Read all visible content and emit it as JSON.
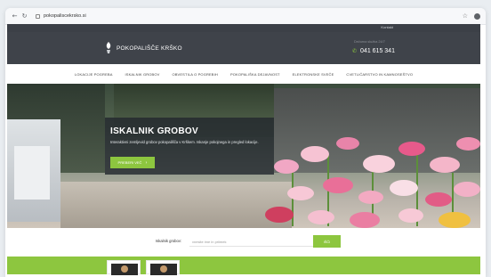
{
  "browser": {
    "url": "pokopaliscekrsko.si",
    "back_icon": "back-arrow-icon",
    "reload_icon": "reload-icon"
  },
  "site": {
    "kontakt": "Kontakt",
    "logo_text": "POKOPALIŠČE KRŠKO",
    "phone_label": "Dežurna služba 24/7",
    "phone": "041 615 341"
  },
  "nav": {
    "items": [
      "LOKACIJE POGREBA",
      "ISKALNIK GROBOV",
      "OBVESTILA O POGREBIH",
      "POKOPALIŠKA DEJAVNOST",
      "ELEKTRONSKE SVEČE",
      "CVETLIČARSTVO IN KAMNOSEŠTVO"
    ]
  },
  "hero": {
    "title": "ISKALNIK GROBOV",
    "description": "Interaktivni zemljevid grobov pokopališča v Krškem. Iskanje pokojnega in pregled lokacije.",
    "button_label": "PREBERI VEČ"
  },
  "search": {
    "label": "Iskalnik grobov:",
    "placeholder": "vnesite ime in priimek",
    "button_label": "IŠČI"
  },
  "colors": {
    "accent": "#8dc63f",
    "header": "#3f434a",
    "topstrip": "#3c4047"
  }
}
